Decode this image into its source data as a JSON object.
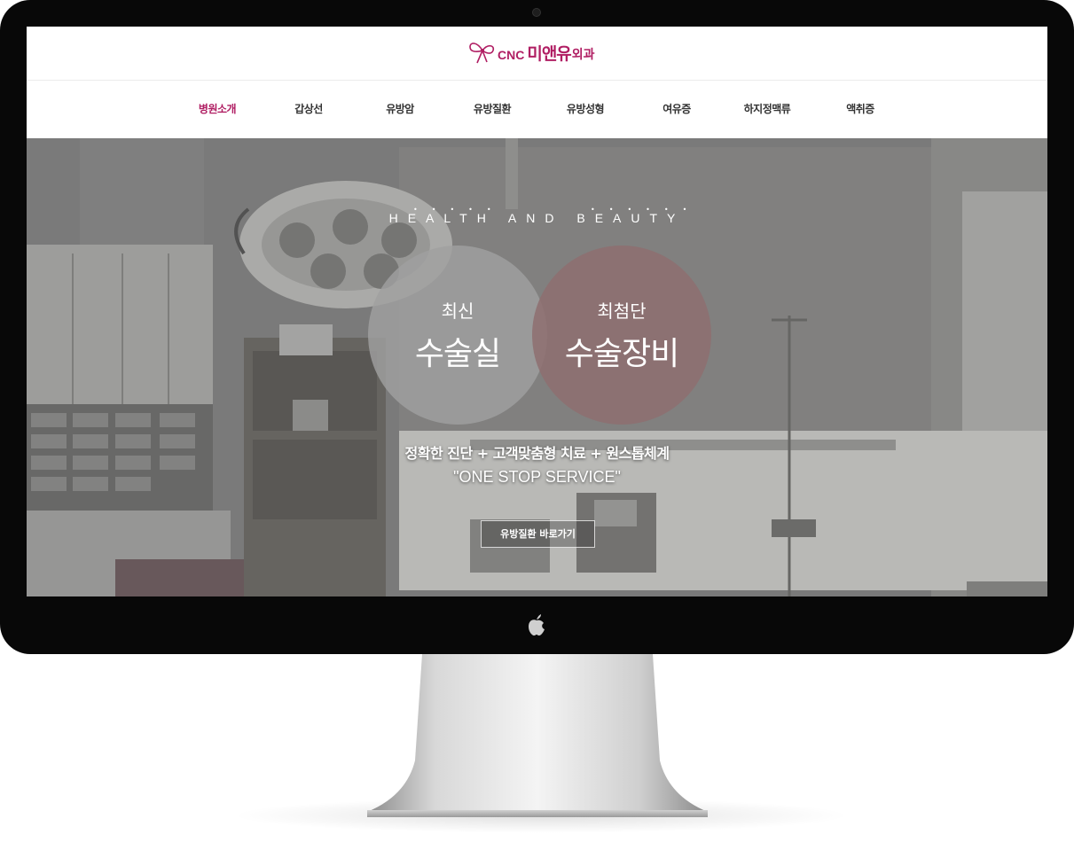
{
  "brand": {
    "logo_prefix": "CNC",
    "logo_name": "미앤유",
    "logo_suffix": "외과",
    "accent_color": "#b01e63"
  },
  "nav": {
    "items": [
      {
        "label": "병원소개",
        "active": true
      },
      {
        "label": "갑상선"
      },
      {
        "label": "유방암"
      },
      {
        "label": "유방질환"
      },
      {
        "label": "유방성형"
      },
      {
        "label": "여유증"
      },
      {
        "label": "하지정맥류"
      },
      {
        "label": "액취증"
      }
    ]
  },
  "hero": {
    "subtitle": "HEALTH AND BEAUTY",
    "circle_left": {
      "small": "최신",
      "big": "수술실"
    },
    "circle_right": {
      "small": "최첨단",
      "big": "수술장비"
    },
    "tagline": "정확한 진단 + 고객맞춤형 치료 + 원스톱체계",
    "tagline2": "\"ONE STOP SERVICE\"",
    "cta_label": "유방질환 바로가기"
  },
  "icons": {
    "logo": "ribbon-icon",
    "monitor_logo": "apple-icon"
  }
}
